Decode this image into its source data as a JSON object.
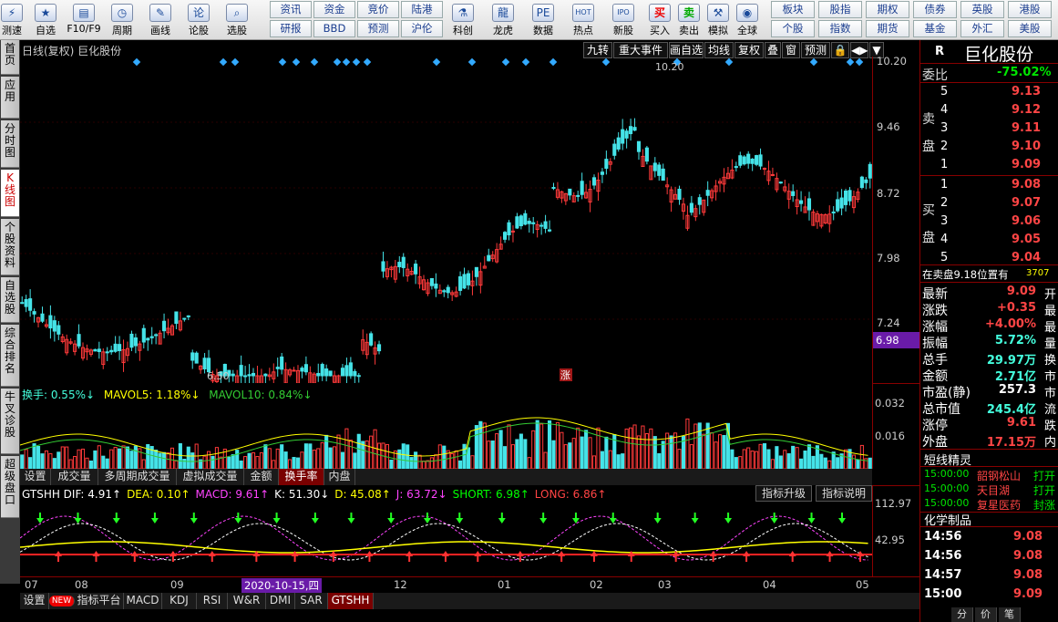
{
  "toolbar": {
    "icons": [
      {
        "label": "测速",
        "icon": "speed-icon",
        "ch": "⚡"
      },
      {
        "label": "自选",
        "icon": "star-icon",
        "ch": "★"
      },
      {
        "label": "F10/F9",
        "icon": "f10-icon",
        "ch": "▤"
      },
      {
        "label": "周期",
        "icon": "clock-icon",
        "ch": "◷"
      },
      {
        "label": "画线",
        "icon": "pen-icon",
        "ch": "✎"
      },
      {
        "label": "论股",
        "icon": "talk-icon",
        "ch": "论"
      },
      {
        "label": "选股",
        "icon": "chart-search-icon",
        "ch": "⌕"
      }
    ],
    "grid": [
      [
        "资讯",
        "资金",
        "竞价",
        "陆港"
      ],
      [
        "研报",
        "BBD",
        "预测",
        "沪伦"
      ]
    ],
    "icons2": [
      {
        "label": "科创",
        "icon": "science-icon",
        "ch": "⚗"
      },
      {
        "label": "龙虎",
        "icon": "dragon-icon",
        "ch": "龍"
      },
      {
        "label": "数据",
        "icon": "pe-icon",
        "ch": "PE"
      },
      {
        "label": "热点",
        "icon": "hot-icon",
        "ch": "HOT"
      },
      {
        "label": "新股",
        "icon": "ipo-icon",
        "ch": "IPO"
      },
      {
        "label": "买入",
        "icon": "buy-icon",
        "ch": "买"
      },
      {
        "label": "卖出",
        "icon": "sell-icon",
        "ch": "卖"
      },
      {
        "label": "模拟",
        "icon": "gavel-icon",
        "ch": "⚒"
      },
      {
        "label": "全球",
        "icon": "globe-icon",
        "ch": "◉"
      }
    ],
    "grid2": [
      [
        "板块",
        "股指",
        "期权",
        "债券",
        "英股",
        "港股"
      ],
      [
        "个股",
        "指数",
        "期货",
        "基金",
        "外汇",
        "美股"
      ]
    ]
  },
  "left_tabs": [
    "首页",
    "应用",
    "分时图",
    "K线图",
    "个股资料",
    "自选股",
    "综合排名",
    "牛叉诊股",
    "超级盘口"
  ],
  "chart": {
    "title": "日线(复权) 巨化股份",
    "menu": [
      "九转",
      "重大事件",
      "画自选",
      "均线",
      "复权",
      "叠",
      "窗",
      "预测",
      "🔒",
      "◀▶",
      "▼"
    ],
    "price_ticks": [
      "10.20",
      "9.46",
      "8.72",
      "7.98",
      "7.24"
    ],
    "current_price_tag": "6.98",
    "high_label": "10.20",
    "low_label": "6.50",
    "zhang_mark": "涨"
  },
  "volume": {
    "legend": [
      {
        "text": "换手: 0.55%↓",
        "color": "#4fd"
      },
      {
        "text": "MAVOL5: 1.18%↓",
        "color": "#ff0"
      },
      {
        "text": "MAVOL10: 0.84%↓",
        "color": "#3c3"
      }
    ],
    "ticks": [
      "0.032",
      "0.016"
    ]
  },
  "tabs_mid": [
    "设置",
    "成交量",
    "多周期成交量",
    "虚拟成交量",
    "金额",
    "换手率",
    "内盘"
  ],
  "indicator": {
    "legend": [
      {
        "text": "GTSHH DIF: 4.91↑",
        "color": "#fff"
      },
      {
        "text": "DEA: 0.10↑",
        "color": "#ff0"
      },
      {
        "text": "MACD: 9.61↑",
        "color": "#f4f"
      },
      {
        "text": "K: 51.30↓",
        "color": "#fff"
      },
      {
        "text": "D: 45.08↑",
        "color": "#ff0"
      },
      {
        "text": "J: 63.72↓",
        "color": "#f4f"
      },
      {
        "text": "SHORT: 6.98↑",
        "color": "#0f0"
      },
      {
        "text": "LONG: 6.86↑",
        "color": "#f44"
      }
    ],
    "buttons": [
      "指标升级",
      "指标说明"
    ],
    "ticks": [
      "112.97",
      "42.95"
    ]
  },
  "xaxis": {
    "labels": [
      "07",
      "08",
      "09",
      "12",
      "01",
      "02",
      "03",
      "04",
      "05"
    ],
    "date_badge": "2020-10-15,四"
  },
  "tabs_bottom": [
    "设置",
    "NEW",
    "指标平台",
    "MACD",
    "KDJ",
    "RSI",
    "W&R",
    "DMI",
    "SAR",
    "GTSHH"
  ],
  "right": {
    "code": "R",
    "name": "巨化股份",
    "weibi_label": "委比",
    "weibi_value": "-75.02%",
    "sell_label": "卖盘",
    "buy_label": "买盘",
    "sells": [
      {
        "lv": "5",
        "p": "9.13"
      },
      {
        "lv": "4",
        "p": "9.12"
      },
      {
        "lv": "3",
        "p": "9.11"
      },
      {
        "lv": "2",
        "p": "9.10"
      },
      {
        "lv": "1",
        "p": "9.09"
      }
    ],
    "buys": [
      {
        "lv": "1",
        "p": "9.08"
      },
      {
        "lv": "2",
        "p": "9.07"
      },
      {
        "lv": "3",
        "p": "9.06"
      },
      {
        "lv": "4",
        "p": "9.05"
      },
      {
        "lv": "5",
        "p": "9.04"
      }
    ],
    "notice": "在卖盘9.18位置有",
    "notice_num": "3707",
    "stats": [
      {
        "k": "最新",
        "v": "9.09",
        "c": "red",
        "s": "开"
      },
      {
        "k": "涨跌",
        "v": "+0.35",
        "c": "red",
        "s": "最"
      },
      {
        "k": "涨幅",
        "v": "+4.00%",
        "c": "red",
        "s": "最"
      },
      {
        "k": "振幅",
        "v": "5.72%",
        "c": "cyan",
        "s": "量"
      },
      {
        "k": "总手",
        "v": "29.97万",
        "c": "cyan",
        "s": "换"
      },
      {
        "k": "金额",
        "v": "2.71亿",
        "c": "cyan",
        "s": "市"
      },
      {
        "k": "市盈(静)",
        "v": "257.3",
        "c": "white",
        "s": "市"
      },
      {
        "k": "总市值",
        "v": "245.4亿",
        "c": "cyan",
        "s": "流"
      },
      {
        "k": "涨停",
        "v": "9.61",
        "c": "red",
        "s": "跌"
      },
      {
        "k": "外盘",
        "v": "17.15万",
        "c": "red",
        "s": "内"
      }
    ],
    "news_title": "短线精灵",
    "news": [
      {
        "t": "15:00:00",
        "n": "韶钢松山",
        "a": "打开"
      },
      {
        "t": "15:00:00",
        "n": "天目湖",
        "a": "打开"
      },
      {
        "t": "15:00:00",
        "n": "复星医药",
        "a": "封涨"
      }
    ],
    "sector": "化学制品",
    "ticks": [
      {
        "t": "14:56",
        "p": "9.08"
      },
      {
        "t": "14:56",
        "p": "9.08"
      },
      {
        "t": "14:57",
        "p": "9.08"
      },
      {
        "t": "15:00",
        "p": "9.09"
      }
    ],
    "bottom_tabs": [
      "分",
      "价",
      "笔"
    ]
  }
}
